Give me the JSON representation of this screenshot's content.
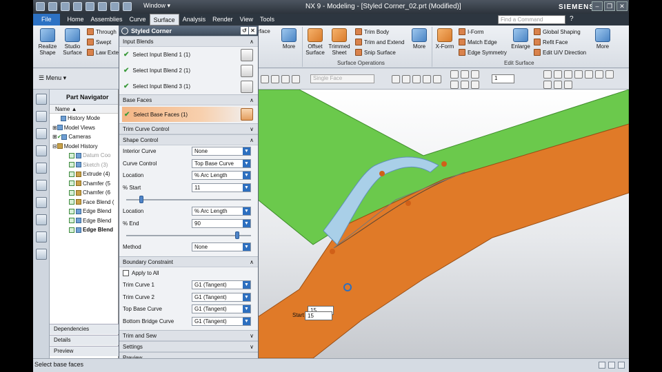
{
  "titlebar": {
    "window_menu": "Window",
    "title": "NX 9 - Modeling - [Styled Corner_02.prt (Modified)]",
    "brand": "SIEMENS",
    "help": "?"
  },
  "menubar": {
    "file": "File",
    "items": [
      "Home",
      "Assemblies",
      "Curve",
      "Surface",
      "Analysis",
      "Render",
      "View",
      "Tools"
    ],
    "active": "Surface",
    "find_placeholder": "Find a Command"
  },
  "ribbon": {
    "realize_shape": "Realize Shape",
    "studio_surface": "Studio Surface",
    "through": "Through",
    "swept": "Swept",
    "law_ext": "Law Exte",
    "face_label": "rface",
    "more1": "More",
    "offset_surface": "Offset Surface",
    "trimmed_sheet": "Trimmed Sheet",
    "trim_body": "Trim Body",
    "trim_extend": "Trim and Extend",
    "snip_surface": "Snip Surface",
    "more2": "More",
    "surface_operations": "Surface Operations",
    "xform": "X-Form",
    "iform": "I-Form",
    "match_edge": "Match Edge",
    "edge_symmetry": "Edge Symmetry",
    "enlarge": "Enlarge",
    "global_shaping": "Global Shaping",
    "refit_face": "Refit Face",
    "edit_uv": "Edit U/V Direction",
    "more3": "More",
    "edit_surface": "Edit Surface"
  },
  "toolbar2": {
    "menu": "Menu",
    "filter": "Single Face",
    "number": "1"
  },
  "navigator": {
    "title": "Part Navigator",
    "column": "Name",
    "items": [
      "History Mode",
      "Model Views",
      "Cameras",
      "Model History",
      "Datum Coo",
      "Sketch (3)",
      "Extrude (4)",
      "Chamfer (5",
      "Chamfer (6",
      "Face Blend (",
      "Edge Blend",
      "Edge Blend",
      "Edge Blend"
    ],
    "footer": [
      "Dependencies",
      "Details",
      "Preview"
    ]
  },
  "dialog": {
    "title": "Styled Corner",
    "sections": {
      "input_blends": "Input Blends",
      "base_faces": "Base Faces",
      "trim_curve": "Trim Curve Control",
      "shape_control": "Shape Control",
      "boundary": "Boundary Constraint",
      "trim_sew": "Trim and Sew",
      "settings": "Settings",
      "preview": "Preview"
    },
    "blends": [
      "Select Input Blend 1 (1)",
      "Select Input Blend 2 (1)",
      "Select Input Blend 3 (1)"
    ],
    "base_faces_row": "Select Base Faces (1)",
    "fields": {
      "interior_curve_label": "Interior Curve",
      "interior_curve_value": "None",
      "curve_control_label": "Curve Control",
      "curve_control_value": "Top Base Curve",
      "location1_label": "Location",
      "location1_value": "% Arc Length",
      "pct_start_label": "% Start",
      "pct_start_value": "11",
      "location2_label": "Location",
      "location2_value": "% Arc Length",
      "pct_end_label": "% End",
      "pct_end_value": "90",
      "method_label": "Method",
      "method_value": "None"
    },
    "sliders": {
      "start": 0.11,
      "end": 0.9
    },
    "boundary": {
      "apply_all": "Apply to All",
      "trim1_label": "Trim Curve 1",
      "trim1_value": "G1 (Tangent)",
      "trim2_label": "Trim Curve 2",
      "trim2_value": "G1 (Tangent)",
      "top_label": "Top Base Curve",
      "top_value": "G1 (Tangent)",
      "bottom_label": "Bottom Bridge Curve",
      "bottom_value": "G1 (Tangent)"
    }
  },
  "viewport": {
    "start_label": "Start",
    "start_value": "15",
    "hidden_value": "15",
    "colors": {
      "green": "#6bc94c",
      "orange": "#e07a28",
      "blue_blend": "#a9cfe8"
    }
  },
  "status": {
    "text": "Select base faces"
  }
}
